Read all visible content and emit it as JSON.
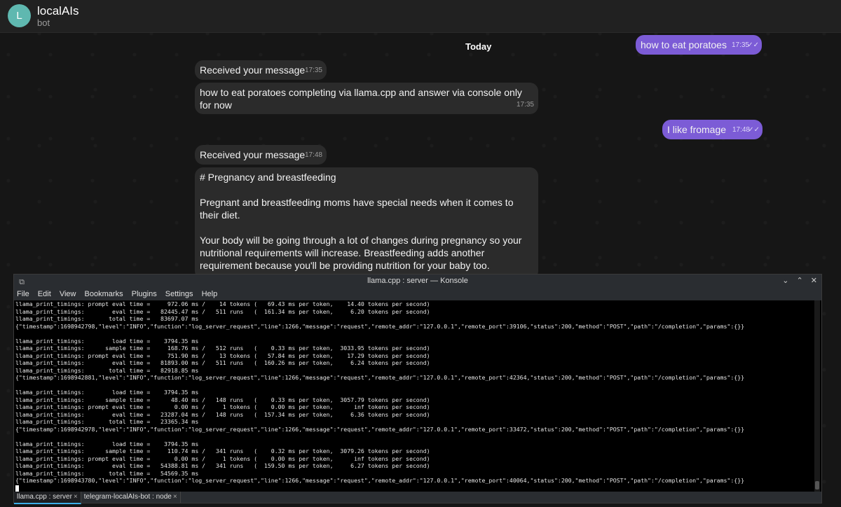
{
  "header": {
    "avatar_letter": "L",
    "title": "localAIs",
    "subtitle": "bot"
  },
  "chat": {
    "date_separator": "Today",
    "messages": [
      {
        "id": "m1",
        "text": "how to eat poratoes",
        "time": "17:35"
      },
      {
        "id": "m2",
        "text": "Received your message",
        "time": "17:35"
      },
      {
        "id": "m3",
        "text": "how to eat poratoes completing via llama.cpp and answer via console only for now",
        "time": "17:35"
      },
      {
        "id": "m4",
        "text": "I like fromage",
        "time": "17:48"
      },
      {
        "id": "m5",
        "text": "Received your message",
        "time": "17:48"
      },
      {
        "id": "m6",
        "line1": "# Pregnancy and breastfeeding",
        "para1": "Pregnant and breastfeeding moms have special needs when it comes to their diet.",
        "para2": "Your body will be going through a lot of changes during pregnancy so your nutritional requirements will increase. Breastfeeding adds another requirement because you'll be providing nutrition for your baby too."
      }
    ],
    "read_ticks": "✓✓"
  },
  "konsole": {
    "title": "llama.cpp : server — Konsole",
    "menu": [
      "File",
      "Edit",
      "View",
      "Bookmarks",
      "Plugins",
      "Settings",
      "Help"
    ],
    "controls": {
      "minimize": "⌄",
      "maximize": "⌃",
      "close": "✕"
    },
    "output": "llama_print_timings: prompt eval time =     972.06 ms /    14 tokens (   69.43 ms per token,    14.40 tokens per second)\nllama_print_timings:        eval time =   82445.47 ms /   511 runs   (  161.34 ms per token,     6.20 tokens per second)\nllama_print_timings:       total time =   83697.07 ms\n{\"timestamp\":1698942798,\"level\":\"INFO\",\"function\":\"log_server_request\",\"line\":1266,\"message\":\"request\",\"remote_addr\":\"127.0.0.1\",\"remote_port\":39106,\"status\":200,\"method\":\"POST\",\"path\":\"/completion\",\"params\":{}}\n\nllama_print_timings:        load time =    3794.35 ms\nllama_print_timings:      sample time =     168.76 ms /   512 runs   (    0.33 ms per token,  3033.95 tokens per second)\nllama_print_timings: prompt eval time =     751.90 ms /    13 tokens (   57.84 ms per token,    17.29 tokens per second)\nllama_print_timings:        eval time =   81893.00 ms /   511 runs   (  160.26 ms per token,     6.24 tokens per second)\nllama_print_timings:       total time =   82918.85 ms\n{\"timestamp\":1698942881,\"level\":\"INFO\",\"function\":\"log_server_request\",\"line\":1266,\"message\":\"request\",\"remote_addr\":\"127.0.0.1\",\"remote_port\":42364,\"status\":200,\"method\":\"POST\",\"path\":\"/completion\",\"params\":{}}\n\nllama_print_timings:        load time =    3794.35 ms\nllama_print_timings:      sample time =      48.40 ms /   148 runs   (    0.33 ms per token,  3057.79 tokens per second)\nllama_print_timings: prompt eval time =       0.00 ms /     1 tokens (    0.00 ms per token,      inf tokens per second)\nllama_print_timings:        eval time =   23287.04 ms /   148 runs   (  157.34 ms per token,     6.36 tokens per second)\nllama_print_timings:       total time =   23365.34 ms\n{\"timestamp\":1698942978,\"level\":\"INFO\",\"function\":\"log_server_request\",\"line\":1266,\"message\":\"request\",\"remote_addr\":\"127.0.0.1\",\"remote_port\":33472,\"status\":200,\"method\":\"POST\",\"path\":\"/completion\",\"params\":{}}\n\nllama_print_timings:        load time =    3794.35 ms\nllama_print_timings:      sample time =     110.74 ms /   341 runs   (    0.32 ms per token,  3079.26 tokens per second)\nllama_print_timings: prompt eval time =       0.00 ms /     1 tokens (    0.00 ms per token,      inf tokens per second)\nllama_print_timings:        eval time =   54388.81 ms /   341 runs   (  159.50 ms per token,     6.27 tokens per second)\nllama_print_timings:       total time =   54569.35 ms\n{\"timestamp\":1698943780,\"level\":\"INFO\",\"function\":\"log_server_request\",\"line\":1266,\"message\":\"request\",\"remote_addr\":\"127.0.0.1\",\"remote_port\":40064,\"status\":200,\"method\":\"POST\",\"path\":\"/completion\",\"params\":{}}\n",
    "tabs": [
      {
        "label": "llama.cpp : server",
        "close": "×"
      },
      {
        "label": "telegram-localAIs-bot : node",
        "close": "×"
      }
    ]
  }
}
